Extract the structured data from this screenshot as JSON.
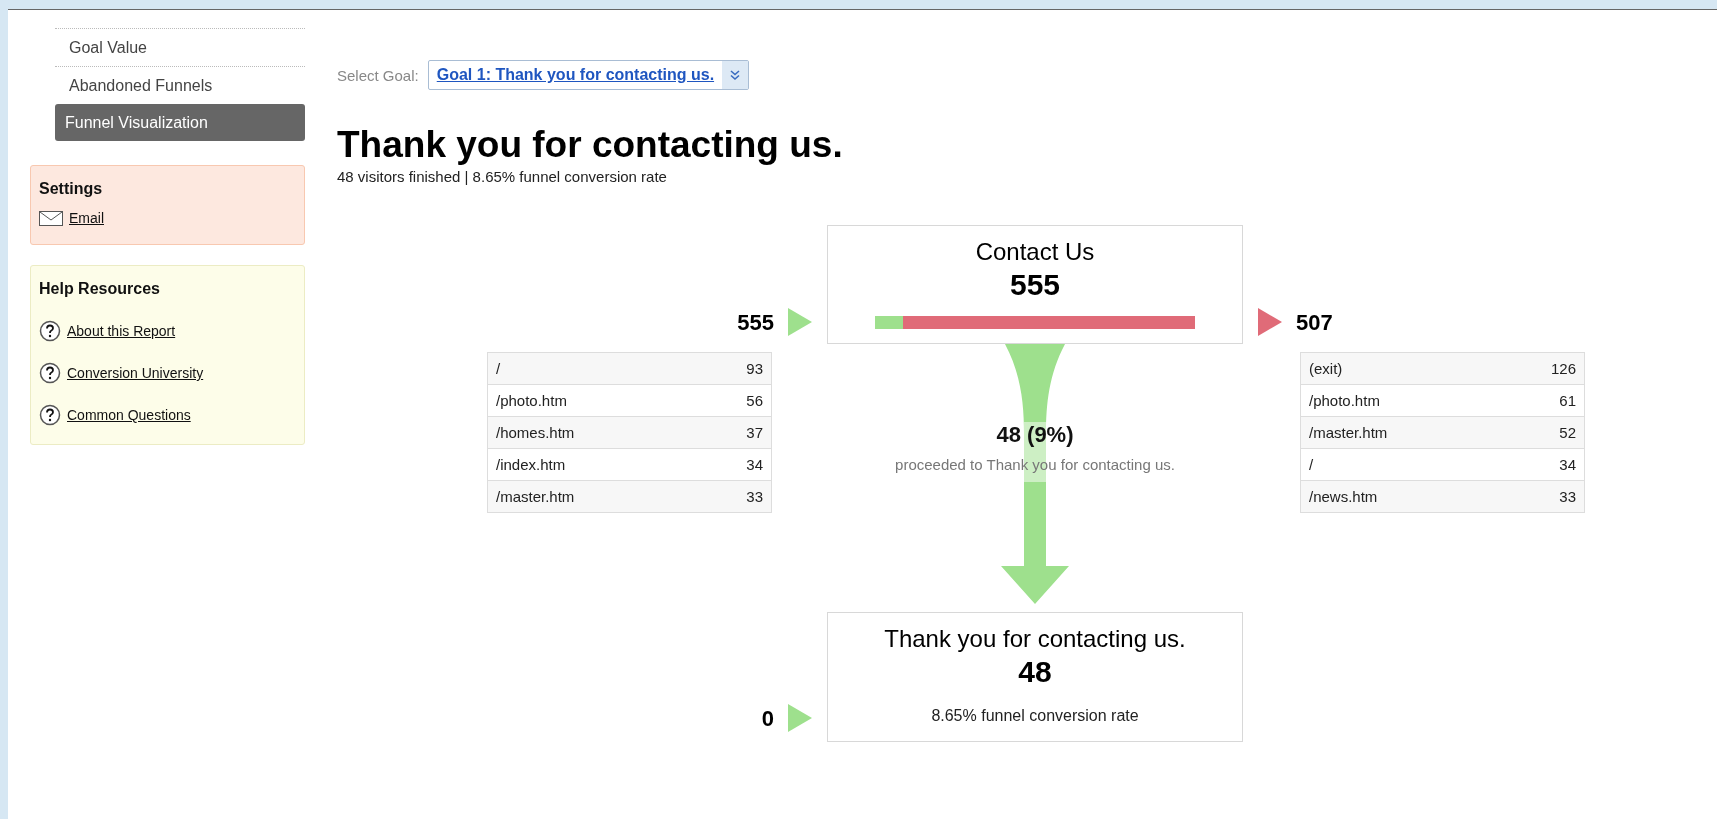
{
  "sidebar": {
    "nav_items": [
      {
        "label": "Goal Value",
        "selected": false
      },
      {
        "label": "Abandoned Funnels",
        "selected": false
      },
      {
        "label": "Funnel Visualization",
        "selected": true
      }
    ],
    "settings": {
      "title": "Settings",
      "links": [
        "Email"
      ]
    },
    "help": {
      "title": "Help Resources",
      "links": [
        "About this Report",
        "Conversion University",
        "Common Questions"
      ]
    }
  },
  "goal_select": {
    "label": "Select Goal:",
    "value": "Goal 1: Thank you for contacting us."
  },
  "title": "Thank you for contacting us.",
  "subtitle": "48 visitors finished | 8.65% funnel conversion rate",
  "funnel": {
    "steps": [
      {
        "name": "Contact Us",
        "count": "555",
        "level": 0.0865,
        "entries": "555",
        "exits": "507",
        "entry_sources": [
          {
            "page": "/",
            "count": "93"
          },
          {
            "page": "/photo.htm",
            "count": "56"
          },
          {
            "page": "/homes.htm",
            "count": "37"
          },
          {
            "page": "/index.htm",
            "count": "34"
          },
          {
            "page": "/master.htm",
            "count": "33"
          }
        ],
        "exit_destinations": [
          {
            "page": "(exit)",
            "count": "126"
          },
          {
            "page": "/photo.htm",
            "count": "61"
          },
          {
            "page": "/master.htm",
            "count": "52"
          },
          {
            "page": "/",
            "count": "34"
          },
          {
            "page": "/news.htm",
            "count": "33"
          }
        ],
        "proceeded": {
          "count": "48 (9%)",
          "text": "proceeded to Thank you for contacting us."
        }
      },
      {
        "name": "Thank you for contacting us.",
        "count": "48",
        "entries": "0",
        "note": "8.65% funnel conversion rate"
      }
    ]
  }
}
